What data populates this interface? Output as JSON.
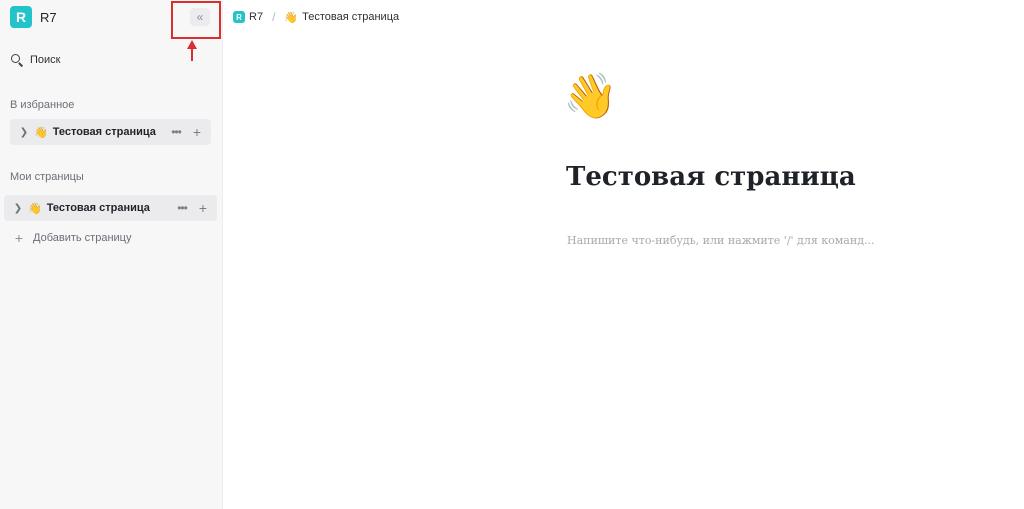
{
  "workspace": {
    "logo_letter": "R",
    "name": "R7"
  },
  "sidebar": {
    "collapse_icon": "«",
    "search_label": "Поиск",
    "favorites_title": "В избранное",
    "favorites": [
      {
        "emoji": "👋",
        "label": "Тестовая страница"
      }
    ],
    "my_pages_title": "Мои страницы",
    "my_pages": [
      {
        "emoji": "👋",
        "label": "Тестовая страница"
      }
    ],
    "add_page_label": "Добавить страницу"
  },
  "breadcrumb": {
    "logo_letter": "R",
    "workspace": "R7",
    "separator": "/",
    "page_emoji": "👋",
    "page": "Тестовая страница"
  },
  "page": {
    "emoji": "👋",
    "title": "Тестовая страница",
    "placeholder": "Напишите что-нибудь, или нажмите '/' для команд..."
  },
  "colors": {
    "accent": "#22c3c9",
    "annotation": "#d9302f"
  }
}
